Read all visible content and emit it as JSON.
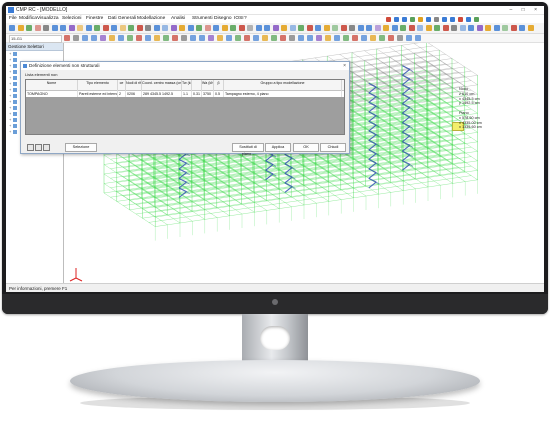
{
  "window": {
    "title": "CMP RC - [MODELLO]",
    "controls": "– □ ×"
  },
  "menu": [
    "File",
    "Modifica",
    "Visualizza",
    "Selezioni",
    "Finestre",
    "Dati Generali",
    "Modellazione",
    "Analisi",
    "Strumenti",
    "Disegno",
    "IOSI",
    "?"
  ],
  "command_box": "15-G1",
  "left_panel": {
    "title": "Gestione Selettori",
    "rows": [
      "",
      "",
      "",
      "",
      "",
      "",
      "",
      "",
      "",
      "",
      "",
      "",
      "",
      ""
    ]
  },
  "dialog": {
    "title": "Definizione elementi non strutturali",
    "close": "×",
    "list_label": "Lista elementi non",
    "columns": [
      "Nome",
      "Tipo elemento",
      "ce",
      "Nodi di rif",
      "Coord. centro massa (cm)",
      "Tw (kN)",
      "",
      "Wa (kN/m)",
      "β",
      "Gruppo a tipo modellazione"
    ],
    "row": [
      "TOMPAGNO",
      "Pareti esterne ed interne",
      "2",
      "0206",
      "289 4345.5 1492.5",
      "1.1",
      "0.31",
      "3750",
      "0.5",
      "Tampagno esterno, 4 piano"
    ],
    "buttons": {
      "selection": "Selezione",
      "filter": "Sostituti di piano...",
      "apply": "Applica",
      "ok": "OK",
      "close": "Chiudi"
    }
  },
  "info_panel": {
    "lines": [
      "Nodo",
      "z 610 cm",
      "x 4345.5 cm",
      "y 1492.5 cm",
      "",
      "Piano",
      "x 578.50 cm",
      "x 4335.00 cm",
      "x 1335.60 cm"
    ]
  },
  "status_bar": "Per informazioni, premere F1",
  "colors": {
    "structure_green": "#3cd84a",
    "structure_grey": "#6e6e6e",
    "stair_blue": "#3b58b5",
    "highlight_yellow": "#f3ef6b",
    "panel_header": "#dbe6f2"
  }
}
